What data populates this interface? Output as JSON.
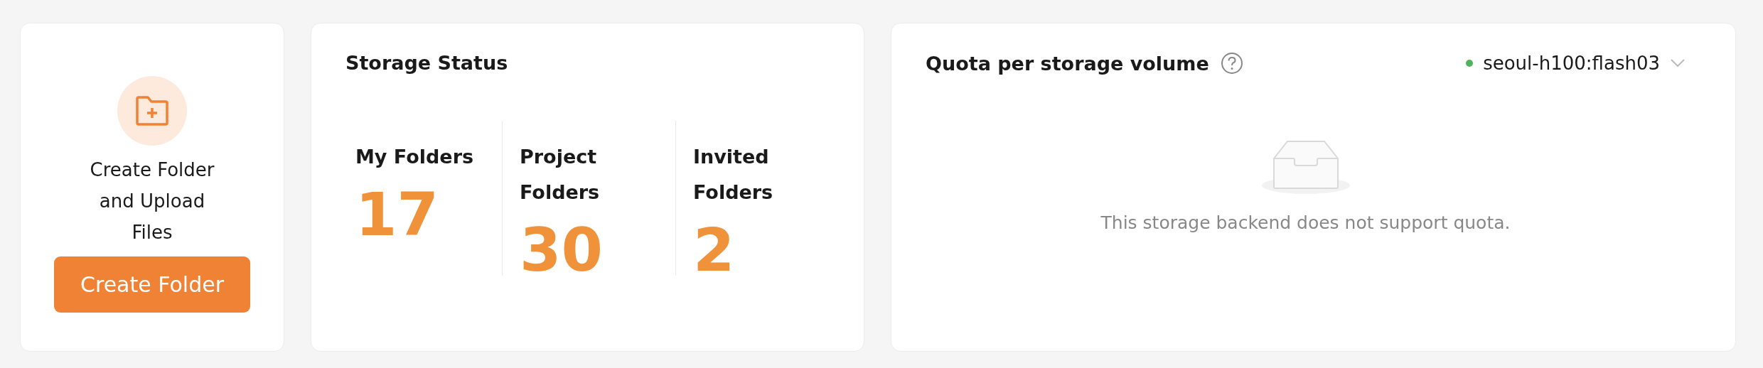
{
  "create_card": {
    "description": "Create Folder and Upload Files",
    "button": "Create Folder"
  },
  "storage_status": {
    "title": "Storage Status",
    "stats": [
      {
        "label": "My Folders",
        "value": "17"
      },
      {
        "label": "Project Folders",
        "value": "30"
      },
      {
        "label": "Invited Folders",
        "value": "2"
      }
    ]
  },
  "quota": {
    "title": "Quota per storage volume",
    "volume": "seoul-h100:flash03",
    "empty_message": "This storage backend does not support quota."
  }
}
